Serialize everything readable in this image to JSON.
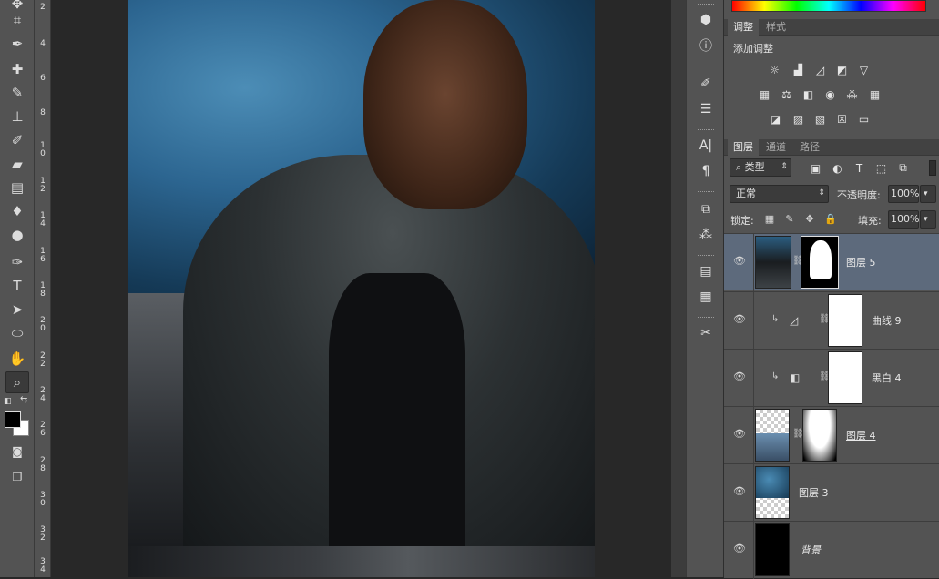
{
  "toolbar": {
    "tools": [
      {
        "name": "move-tool-icon",
        "glyph": "✥"
      },
      {
        "name": "crop-tool-icon",
        "glyph": "⌗"
      },
      {
        "name": "eyedropper-tool-icon",
        "glyph": "✒"
      },
      {
        "name": "healing-brush-tool-icon",
        "glyph": "✚"
      },
      {
        "name": "brush-tool-icon",
        "glyph": "✎"
      },
      {
        "name": "clone-stamp-tool-icon",
        "glyph": "⊥"
      },
      {
        "name": "history-brush-tool-icon",
        "glyph": "✐"
      },
      {
        "name": "eraser-tool-icon",
        "glyph": "▰"
      },
      {
        "name": "gradient-tool-icon",
        "glyph": "▤"
      },
      {
        "name": "blur-tool-icon",
        "glyph": "♦"
      },
      {
        "name": "dodge-tool-icon",
        "glyph": "●"
      },
      {
        "name": "pen-tool-icon",
        "glyph": "✑"
      },
      {
        "name": "type-tool-icon",
        "glyph": "T"
      },
      {
        "name": "path-selection-tool-icon",
        "glyph": "➤"
      },
      {
        "name": "ellipse-tool-icon",
        "glyph": "⬭"
      },
      {
        "name": "hand-tool-icon",
        "glyph": "✋"
      },
      {
        "name": "zoom-tool-icon",
        "glyph": "🔍"
      }
    ],
    "active_tool": "zoom-tool-icon",
    "foreground_color": "#000000",
    "background_color": "#ffffff"
  },
  "ruler": {
    "labels": [
      "2",
      "4",
      "6",
      "8",
      "10",
      "12",
      "14",
      "16",
      "18",
      "20",
      "22",
      "24",
      "26",
      "28",
      "30",
      "32",
      "34"
    ]
  },
  "icon_strip": {
    "icons": [
      "3d-icon",
      "info-icon",
      "brushes-icon",
      "adjustments-icon",
      "character-icon",
      "paragraph-icon",
      "clone-source-icon",
      "character-styles-icon",
      "notes-icon",
      "paragraph-styles-icon",
      "tools-icon"
    ]
  },
  "adjustments_panel": {
    "tabs": [
      "调整",
      "样式"
    ],
    "title": "添加调整",
    "row1": [
      "brightness-icon",
      "levels-icon",
      "curves-icon",
      "exposure-icon",
      "vibrance-icon"
    ],
    "row2": [
      "hue-saturation-icon",
      "color-balance-icon",
      "black-white-icon",
      "photo-filter-icon",
      "channel-mixer-icon",
      "color-lookup-icon"
    ],
    "row3": [
      "invert-icon",
      "posterize-icon",
      "threshold-icon",
      "selective-color-icon",
      "gradient-map-icon"
    ]
  },
  "layers_panel": {
    "tabs": [
      "图层",
      "通道",
      "路径"
    ],
    "filter_label": "类型",
    "blend_mode": "正常",
    "opacity_label": "不透明度:",
    "opacity_value": "100%",
    "lock_label": "锁定:",
    "fill_label": "填充:",
    "fill_value": "100%",
    "layers": [
      {
        "name": "图层 5",
        "type": "pixel-mask",
        "selected": true
      },
      {
        "name": "曲线 9",
        "type": "curves",
        "selected": false
      },
      {
        "name": "黑白 4",
        "type": "black-white",
        "selected": false
      },
      {
        "name": "图层 4",
        "type": "pixel-mask",
        "selected": false
      },
      {
        "name": "图层 3",
        "type": "pixel",
        "selected": false
      },
      {
        "name": "背景",
        "type": "background",
        "selected": false
      }
    ]
  }
}
